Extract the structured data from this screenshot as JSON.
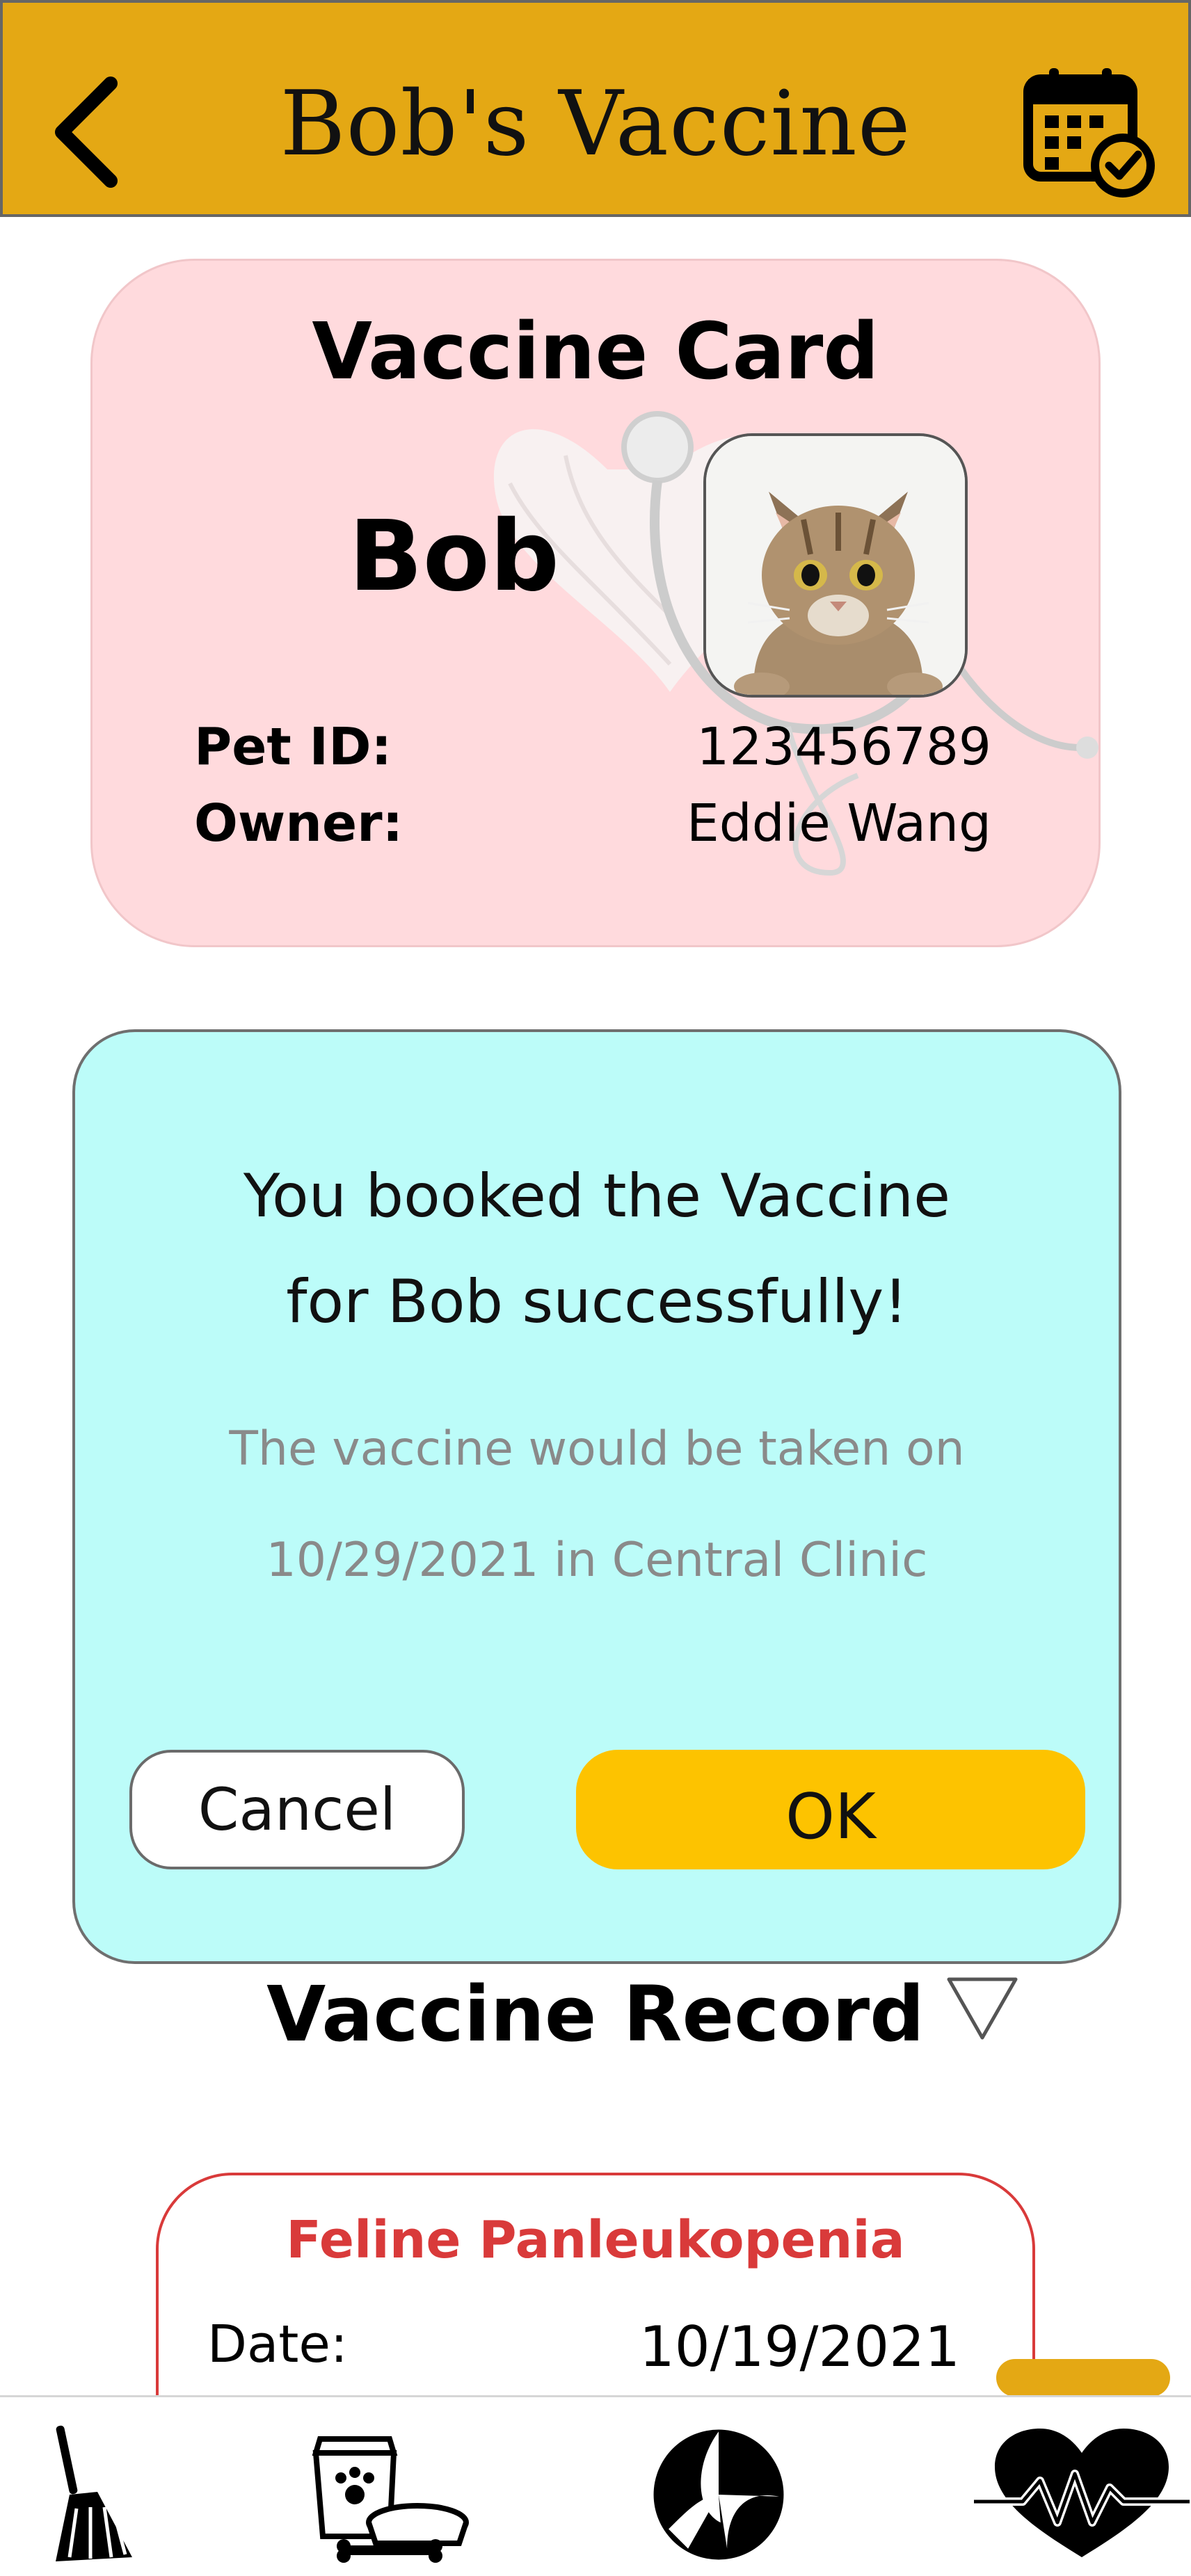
{
  "header": {
    "title": "Bob's Vaccine",
    "back_icon": "chevron-left-icon",
    "calendar_icon": "calendar-check-icon",
    "bg_color": "#e4a814"
  },
  "card": {
    "title": "Vaccine Card",
    "pet_name": "Bob",
    "pet_id_label": "Pet ID:",
    "pet_id_value": "123456789",
    "owner_label": "Owner:",
    "owner_value": "Eddie Wang",
    "bg_color": "#ffdadd"
  },
  "dialog": {
    "title_line1": "You booked the Vaccine",
    "title_line2": "for Bob successfully!",
    "message_line1": "The vaccine would be taken on",
    "message_line2": "10/29/2021 in Central Clinic",
    "cancel_label": "Cancel",
    "ok_label": "OK",
    "bg_color": "#bcfcf9",
    "ok_color": "#fdc300"
  },
  "record": {
    "heading": "Vaccine Record",
    "items": [
      {
        "name": "Feline Panleukopenia",
        "date_label": "Date:",
        "date_value": "10/19/2021"
      }
    ],
    "accent_color": "#d93a3a"
  },
  "nav": {
    "items": [
      {
        "icon": "broom-icon"
      },
      {
        "icon": "pet-food-icon"
      },
      {
        "icon": "ball-icon"
      },
      {
        "icon": "heartbeat-icon"
      }
    ]
  }
}
